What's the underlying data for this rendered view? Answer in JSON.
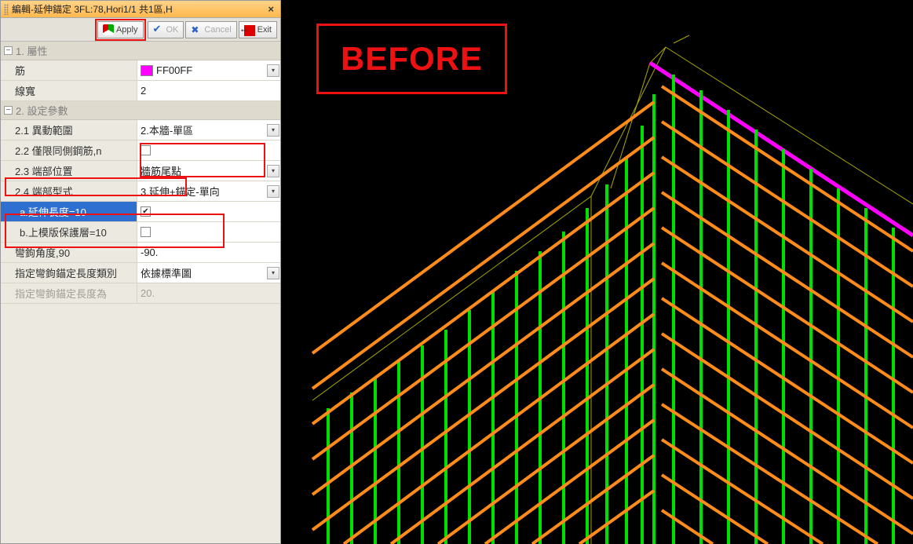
{
  "window": {
    "title": "編輯-延伸錨定 3FL:78,Hori1/1 共1區,H"
  },
  "toolbar": {
    "apply": "Apply",
    "ok": "OK",
    "cancel": "Cancel",
    "exit": "Exit"
  },
  "sections": {
    "props": {
      "title": "1. 屬性"
    },
    "params": {
      "title": "2. 設定參數"
    }
  },
  "rows": {
    "rebar": {
      "label": "筋",
      "value": "FF00FF",
      "swatch": "#ff00ff"
    },
    "lineWidth": {
      "label": "線寬",
      "value": "2"
    },
    "scope": {
      "label": "2.1 異動範圍",
      "value": "2.本牆-單區"
    },
    "sameSideOnly": {
      "label": "2.2 僅限同側鋼筋,n",
      "checked": false
    },
    "endPos": {
      "label": "2.3 端部位置",
      "value": "牆筋尾點"
    },
    "endType": {
      "label": "2.4 端部型式",
      "value": "3.延伸+錨定-單向"
    },
    "extLen": {
      "label": "a.延伸長度=10",
      "checked": true
    },
    "upperCover": {
      "label": "b.上模版保護層=10",
      "checked": false
    },
    "hookAngle": {
      "label": "彎鉤角度,90",
      "value": "-90."
    },
    "hookLenType": {
      "label": "指定彎鉤錨定長度類別",
      "value": "依據標準圖"
    },
    "hookLenValue": {
      "label": "指定彎鉤錨定長度為",
      "value": "20."
    }
  },
  "viewport": {
    "label": "BEFORE",
    "colors": {
      "vertical": "#00ff00",
      "horizontal": "#ff9423",
      "edge_thin": "#a8a800",
      "highlight": "#ff00ff"
    }
  }
}
